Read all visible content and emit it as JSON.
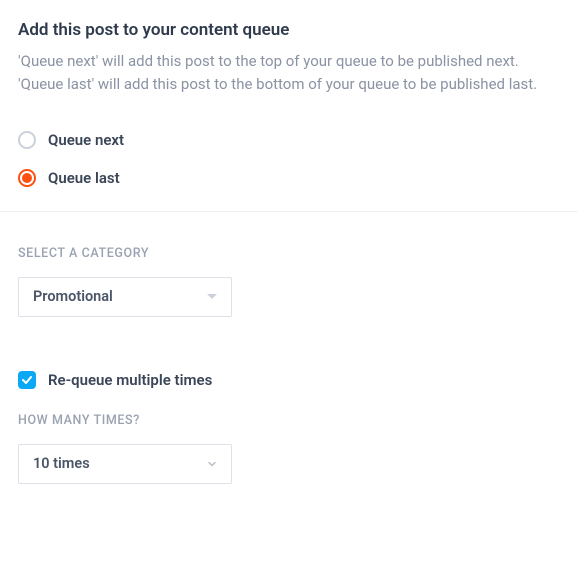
{
  "header": {
    "title": "Add this post to your content queue",
    "description": "'Queue next' will add this post to the top of your queue to be published next. 'Queue last' will add this post to the bottom of your queue to be published last."
  },
  "queue_options": {
    "next_label": "Queue next",
    "last_label": "Queue last",
    "selected": "last"
  },
  "category": {
    "label": "SELECT A CATEGORY",
    "selected": "Promotional"
  },
  "requeue": {
    "checkbox_label": "Re-queue multiple times",
    "checked": true,
    "times_label": "HOW MANY TIMES?",
    "times_selected": "10 times"
  },
  "colors": {
    "accent_radio": "#ff4f0f",
    "accent_checkbox": "#0aa8f5"
  }
}
